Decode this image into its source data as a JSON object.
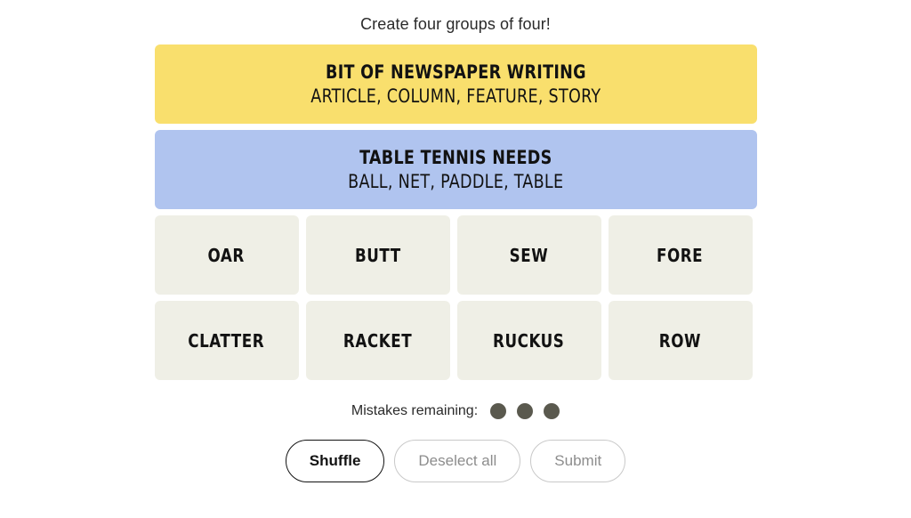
{
  "game": {
    "instruction": "Create four groups of four!"
  },
  "solved_groups": [
    {
      "title": "BIT OF NEWSPAPER WRITING",
      "members": "ARTICLE, COLUMN, FEATURE, STORY",
      "color": "#f9df6d",
      "difficulty": "yellow"
    },
    {
      "title": "TABLE TENNIS NEEDS",
      "members": "BALL, NET, PADDLE, TABLE",
      "color": "#b0c4ef",
      "difficulty": "blue"
    }
  ],
  "tile_rows": [
    [
      {
        "label": "OAR"
      },
      {
        "label": "BUTT"
      },
      {
        "label": "SEW"
      },
      {
        "label": "FORE"
      }
    ],
    [
      {
        "label": "CLATTER"
      },
      {
        "label": "RACKET"
      },
      {
        "label": "RUCKUS"
      },
      {
        "label": "ROW"
      }
    ]
  ],
  "mistakes": {
    "label": "Mistakes remaining:",
    "remaining": 3,
    "dot_color": "#5a594e"
  },
  "controls": {
    "shuffle_label": "Shuffle",
    "deselect_label": "Deselect all",
    "submit_label": "Submit"
  }
}
